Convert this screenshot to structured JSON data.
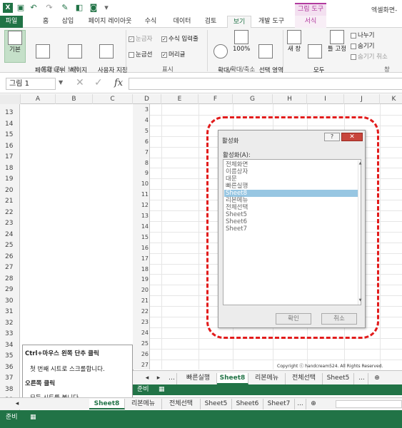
{
  "titlebar": {
    "picture_tools": "그림 도구",
    "doc_title": "엑셀화면-"
  },
  "tabs": [
    "파일",
    "홈",
    "삽입",
    "페이지 레이아웃",
    "수식",
    "데이터",
    "검토",
    "보기",
    "개발 도구",
    "서식"
  ],
  "ribbon": {
    "groups": [
      "통합 문서 보기",
      "표시",
      "확대/축소",
      "창"
    ],
    "views": [
      {
        "label": "기본",
        "selected": true
      },
      {
        "label": "페이지 나누\n기 미리 보기"
      },
      {
        "label": "페이지\n레이아웃"
      },
      {
        "label": "사용자 지정\n보기"
      }
    ],
    "show": [
      {
        "label": "눈금자",
        "checked": true,
        "disabled": true
      },
      {
        "label": "수식 입력줄",
        "checked": true
      },
      {
        "label": "눈금선",
        "checked": false
      },
      {
        "label": "머리글",
        "checked": true
      }
    ],
    "zoom": [
      {
        "label": "확대/\n축소"
      },
      {
        "label": "100%"
      },
      {
        "label": "선택 영역\n확대/축소"
      }
    ],
    "window": [
      {
        "label": "새 창"
      },
      {
        "label": "모두\n정렬"
      },
      {
        "label": "틀 고정"
      }
    ],
    "window_small": [
      "나누기",
      "숨기기",
      "숨기기 취소"
    ]
  },
  "formula_bar": {
    "name_box": "그림 1",
    "fx": "fx"
  },
  "columns": [
    "A",
    "B",
    "C",
    "D",
    "E",
    "F",
    "G",
    "H",
    "I",
    "J",
    "K"
  ],
  "outer_rows": [
    "13",
    "14",
    "15",
    "16",
    "17",
    "18",
    "19",
    "20",
    "21",
    "22",
    "23",
    "24",
    "25",
    "26",
    "27",
    "28",
    "29",
    "30",
    "31",
    "32",
    "33",
    "34",
    "35",
    "36",
    "37",
    "38",
    "39"
  ],
  "inner_rows": [
    "3",
    "4",
    "5",
    "6",
    "7",
    "8",
    "9",
    "10",
    "11",
    "12",
    "13",
    "14",
    "15",
    "16",
    "17",
    "18",
    "19",
    "20",
    "21",
    "22",
    "23",
    "24",
    "25",
    "26",
    "27"
  ],
  "dialog": {
    "title": "활성화",
    "label": "활성화(A):",
    "items": [
      "전체화면",
      "이름상자",
      "대문",
      "빠른실행",
      "Sheet8",
      "리본메뉴",
      "전체선택",
      "Sheet5",
      "Sheet6",
      "Sheet7"
    ],
    "selected_index": 4,
    "ok": "확인",
    "cancel": "취소",
    "help": "?",
    "close": "✕"
  },
  "copyright": "Copyright ⓒ handcream524. All Rights Reserved.",
  "inner_tabs": [
    "빠른실행",
    "Sheet8",
    "리본메뉴",
    "전체선택",
    "Sheet5",
    "..."
  ],
  "inner_active_tab": "Sheet8",
  "inner_status": "준비",
  "tooltip": {
    "l1": "Ctrl+마우스 왼쪽 단추 클릭",
    "l2": "첫 번째 시트로 스크롤합니다.",
    "l3": "오른쪽 클릭",
    "l4": "모든 시트를 봅니다."
  },
  "outer_tabs": [
    "Sheet8",
    "리본메뉴",
    "전체선택",
    "Sheet5",
    "Sheet6",
    "Sheet7",
    "..."
  ],
  "outer_active_tab": "Sheet8",
  "outer_status": "준비",
  "colors": {
    "excel_green": "#217346",
    "format_pink": "#b13a9e",
    "dashed_red": "#e21c1c",
    "list_selected": "#97c6e2"
  }
}
